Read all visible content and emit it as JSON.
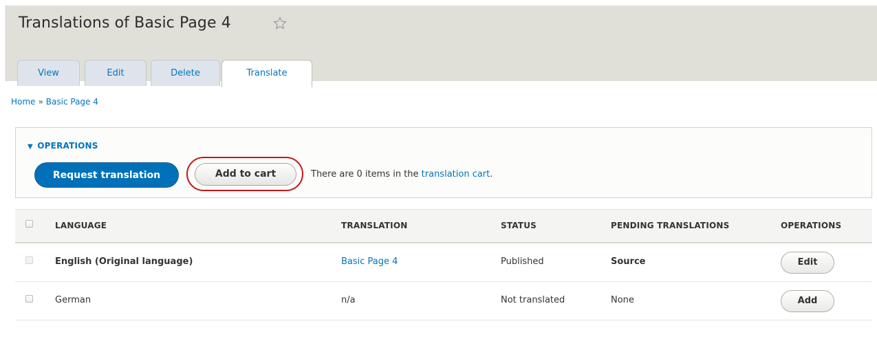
{
  "page": {
    "title": "Translations of Basic Page 4"
  },
  "tabs": [
    {
      "label": "View"
    },
    {
      "label": "Edit"
    },
    {
      "label": "Delete"
    },
    {
      "label": "Translate"
    }
  ],
  "breadcrumb": {
    "home": "Home",
    "separator": "»",
    "current": "Basic Page 4"
  },
  "operations": {
    "heading": "OPERATIONS",
    "request_button": "Request translation",
    "cart_button": "Add to cart",
    "cart_text_prefix": "There are 0 items in the ",
    "cart_link": "translation cart",
    "cart_text_suffix": "."
  },
  "table": {
    "headers": {
      "language": "LANGUAGE",
      "translation": "TRANSLATION",
      "status": "STATUS",
      "pending": "PENDING TRANSLATIONS",
      "operations": "OPERATIONS"
    },
    "rows": [
      {
        "language": "English (Original language)",
        "translation": "Basic Page 4",
        "status": "Published",
        "pending": "Source",
        "operation": "Edit"
      },
      {
        "language": "German",
        "translation": "n/a",
        "status": "Not translated",
        "pending": "None",
        "operation": "Add"
      }
    ]
  },
  "colors": {
    "accent": "#0074bd",
    "primary_button": "#0071b8",
    "highlight_ring": "#c1161c"
  }
}
